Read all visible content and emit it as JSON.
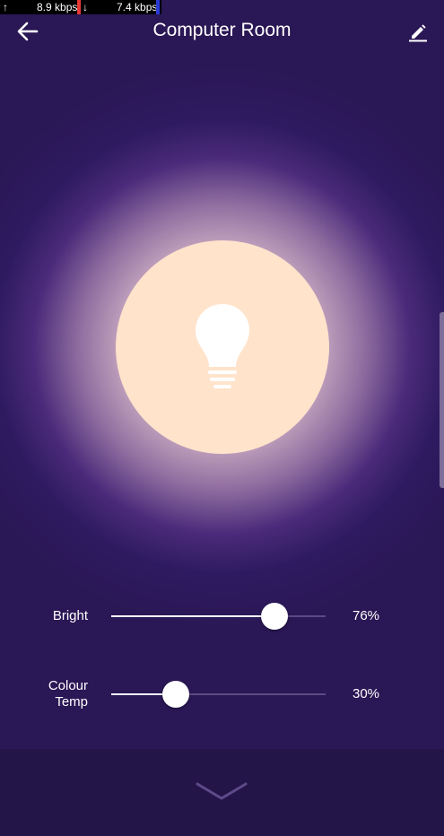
{
  "status_bar": {
    "upload_arrow": "↑",
    "upload_rate": "8.9 kbps",
    "download_arrow": "↓",
    "download_rate": "7.4 kbps"
  },
  "header": {
    "title": "Computer Room",
    "back_icon": "arrow-left-icon",
    "edit_icon": "pencil-icon"
  },
  "light": {
    "icon": "lightbulb-icon",
    "color": "#ffe3cb"
  },
  "controls": {
    "brightness": {
      "label": "Bright",
      "value_text": "76%",
      "level": 0.76
    },
    "colour_temp": {
      "label_line1": "Colour",
      "label_line2": "Temp",
      "value_text": "30%",
      "level": 0.3
    }
  },
  "footer": {
    "expand_icon": "chevron-down-icon"
  },
  "colors": {
    "background": "#2a1755",
    "accent": "#ffffff",
    "track_inactive": "#5b4a85",
    "footer": "#231548"
  }
}
